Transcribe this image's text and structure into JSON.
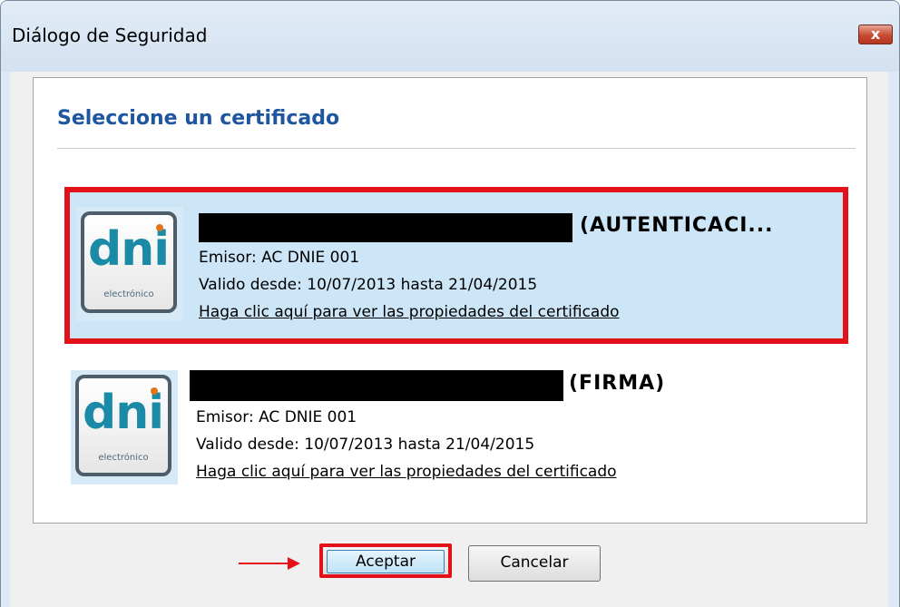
{
  "window": {
    "title": "Diálogo de Seguridad",
    "close_label": "x"
  },
  "panel": {
    "heading": "Seleccione un certificado"
  },
  "certificates": [
    {
      "name_suffix": "(AUTENTICACI...",
      "issuer": "Emisor: AC DNIE 001",
      "validity": "Valido desde: 10/07/2013 hasta 21/04/2015",
      "link": "Haga clic aquí para ver las propiedades del certificado",
      "icon_text": "dni",
      "icon_sub": "electrónico",
      "selected": true
    },
    {
      "name_suffix": "(FIRMA)",
      "issuer": "Emisor: AC DNIE 001",
      "validity": "Valido desde: 10/07/2013 hasta 21/04/2015",
      "link": "Haga clic aquí para ver las propiedades del certificado",
      "icon_text": "dni",
      "icon_sub": "electrónico",
      "selected": false
    }
  ],
  "buttons": {
    "ok": "Aceptar",
    "cancel": "Cancelar"
  },
  "colors": {
    "highlight": "#e2111a",
    "heading": "#1e56a0",
    "selected_bg": "#cde6f7"
  },
  "icons": {
    "close": "close-icon",
    "certificate": "dni-electronico-icon",
    "pointer": "red-arrow-icon"
  }
}
